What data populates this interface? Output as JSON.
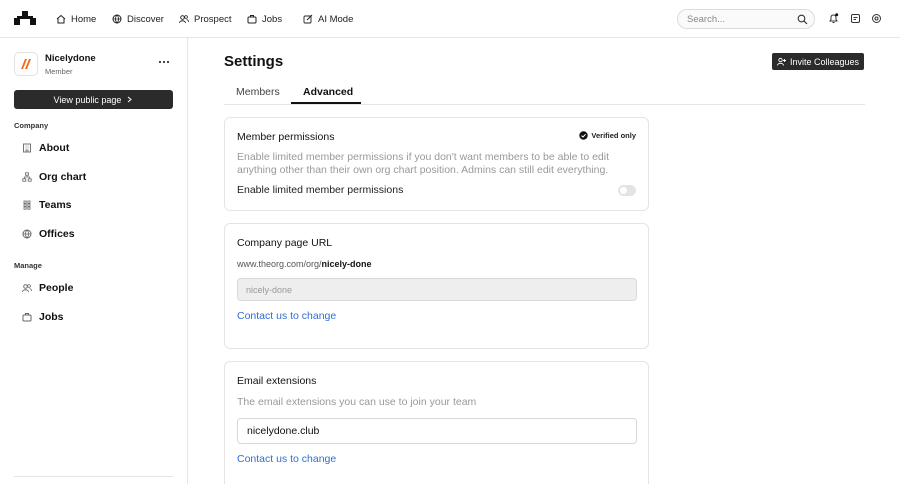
{
  "topbar": {
    "nav": [
      {
        "label": "Home",
        "icon": "home-icon"
      },
      {
        "label": "Discover",
        "icon": "globe-icon"
      },
      {
        "label": "Prospect",
        "icon": "users-icon"
      },
      {
        "label": "Jobs",
        "icon": "briefcase-icon"
      },
      {
        "label": "AI Mode",
        "icon": "edit-icon"
      }
    ],
    "search_placeholder": "Search...",
    "icons": [
      "bell-icon",
      "messages-icon",
      "settings-icon"
    ]
  },
  "sidebar": {
    "org_name": "Nicelydone",
    "org_role": "Member",
    "view_public_label": "View public page",
    "company_label": "Company",
    "company_items": [
      {
        "label": "About",
        "icon": "building-icon"
      },
      {
        "label": "Org chart",
        "icon": "org-chart-icon"
      },
      {
        "label": "Teams",
        "icon": "teams-icon"
      },
      {
        "label": "Offices",
        "icon": "globe-icon"
      }
    ],
    "manage_label": "Manage",
    "manage_items": [
      {
        "label": "People",
        "icon": "people-icon"
      },
      {
        "label": "Jobs",
        "icon": "briefcase-icon"
      }
    ]
  },
  "main": {
    "title": "Settings",
    "invite_label": "Invite Colleagues",
    "tabs": [
      {
        "label": "Members",
        "active": false
      },
      {
        "label": "Advanced",
        "active": true
      }
    ],
    "member_permissions": {
      "title": "Member permissions",
      "badge": "Verified only",
      "description": "Enable limited member permissions if you don't want members to be able to edit anything other than their own org chart position. Admins can still edit everything.",
      "toggle_label": "Enable limited member permissions",
      "toggle_on": false
    },
    "company_url": {
      "title": "Company page URL",
      "url_prefix": "www.theorg.com/org/",
      "url_slug": "nicely-done",
      "input_value": "nicely-done",
      "link": "Contact us to change"
    },
    "email_extensions": {
      "title": "Email extensions",
      "description": "The email extensions you can use to join your team",
      "input_value": "nicelydone.club",
      "link": "Contact us to change"
    }
  },
  "colors": {
    "dark_button": "#2b2b2b",
    "link": "#2f6fd6",
    "brand_orange": "#f26b1d"
  }
}
